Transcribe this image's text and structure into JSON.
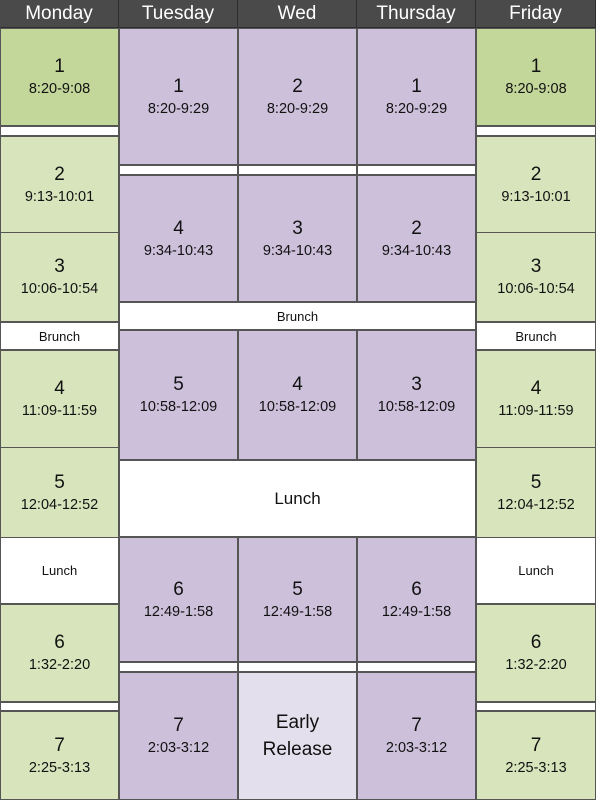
{
  "colors": {
    "header": "#4a4a4a",
    "green_dark": "#c4d79b",
    "green_light": "#d8e4bc",
    "purple": "#ccc0da",
    "purple_light": "#e4dfec",
    "break": "#ffffff"
  },
  "headers": [
    "Monday",
    "Tuesday",
    "Wed",
    "Thursday",
    "Friday"
  ],
  "monday": [
    {
      "period": "1",
      "time": "8:20-9:08"
    },
    {
      "period": "2",
      "time": "9:13-10:01"
    },
    {
      "period": "3",
      "time": "10:06-10:54"
    },
    {
      "label": "Brunch"
    },
    {
      "period": "4",
      "time": "11:09-11:59"
    },
    {
      "period": "5",
      "time": "12:04-12:52"
    },
    {
      "label": "Lunch"
    },
    {
      "period": "6",
      "time": "1:32-2:20"
    },
    {
      "period": "7",
      "time": "2:25-3:13"
    }
  ],
  "tuesday": [
    {
      "period": "1",
      "time": "8:20-9:29"
    },
    {
      "period": "4",
      "time": "9:34-10:43"
    },
    {
      "period": "5",
      "time": "10:58-12:09"
    },
    {
      "period": "6",
      "time": "12:49-1:58"
    },
    {
      "period": "7",
      "time": "2:03-3:12"
    }
  ],
  "wed": [
    {
      "period": "2",
      "time": "8:20-9:29"
    },
    {
      "period": "3",
      "time": "9:34-10:43"
    },
    {
      "period": "4",
      "time": "10:58-12:09"
    },
    {
      "period": "5",
      "time": "12:49-1:58"
    },
    {
      "label": "Early Release"
    }
  ],
  "thursday": [
    {
      "period": "1",
      "time": "8:20-9:29"
    },
    {
      "period": "2",
      "time": "9:34-10:43"
    },
    {
      "period": "3",
      "time": "10:58-12:09"
    },
    {
      "period": "6",
      "time": "12:49-1:58"
    },
    {
      "period": "7",
      "time": "2:03-3:12"
    }
  ],
  "midweek_breaks": {
    "brunch": "Brunch",
    "lunch": "Lunch"
  },
  "friday": [
    {
      "period": "1",
      "time": "8:20-9:08"
    },
    {
      "period": "2",
      "time": "9:13-10:01"
    },
    {
      "period": "3",
      "time": "10:06-10:54"
    },
    {
      "label": "Brunch"
    },
    {
      "period": "4",
      "time": "11:09-11:59"
    },
    {
      "period": "5",
      "time": "12:04-12:52"
    },
    {
      "label": "Lunch"
    },
    {
      "period": "6",
      "time": "1:32-2:20"
    },
    {
      "period": "7",
      "time": "2:25-3:13"
    }
  ]
}
